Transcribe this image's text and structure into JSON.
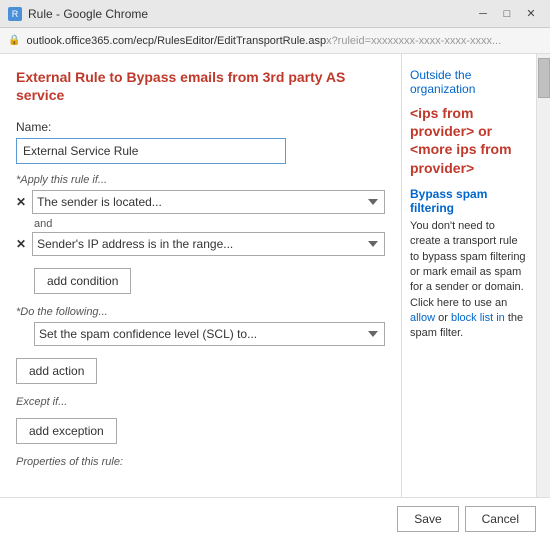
{
  "titleBar": {
    "icon": "R",
    "title": "Rule - Google Chrome",
    "controls": {
      "minimize": "─",
      "maximize": "□",
      "close": "✕"
    }
  },
  "addressBar": {
    "url_main": "outlook.office365.com/ecp/RulesEditor/EditTransportRule.asp",
    "url_rest": "x?ruleid=xxxxxxxx-xxxx-xxxx-xxxx..."
  },
  "page": {
    "title": "External Rule to Bypass emails from 3rd party AS service",
    "name_label": "Name:",
    "name_value": "External Service Rule",
    "apply_label": "*Apply this rule if...",
    "condition1": "The sender is located...",
    "and_text": "and",
    "condition2": "Sender's IP address is in the range...",
    "add_condition_label": "add condition",
    "do_label": "*Do the following...",
    "action1": "Set the spam confidence level (SCL) to...",
    "add_action_label": "add action",
    "except_label": "Except if...",
    "add_exception_label": "add exception",
    "properties_label": "Properties of this rule:"
  },
  "sidePanel": {
    "link1": "Outside the organization",
    "ips_text": "<ips from provider> or <more ips from provider>",
    "bypass_title": "Bypass spam filtering",
    "bypass_body": "You don't need to create a transport rule to bypass spam filtering or mark email as spam for a sender or domain. Click here to use an",
    "allow_link": "allow",
    "or_text": "or",
    "block_link": "block list in",
    "block_text2": "the spam filter."
  },
  "bottomBar": {
    "save_label": "Save",
    "cancel_label": "Cancel"
  }
}
